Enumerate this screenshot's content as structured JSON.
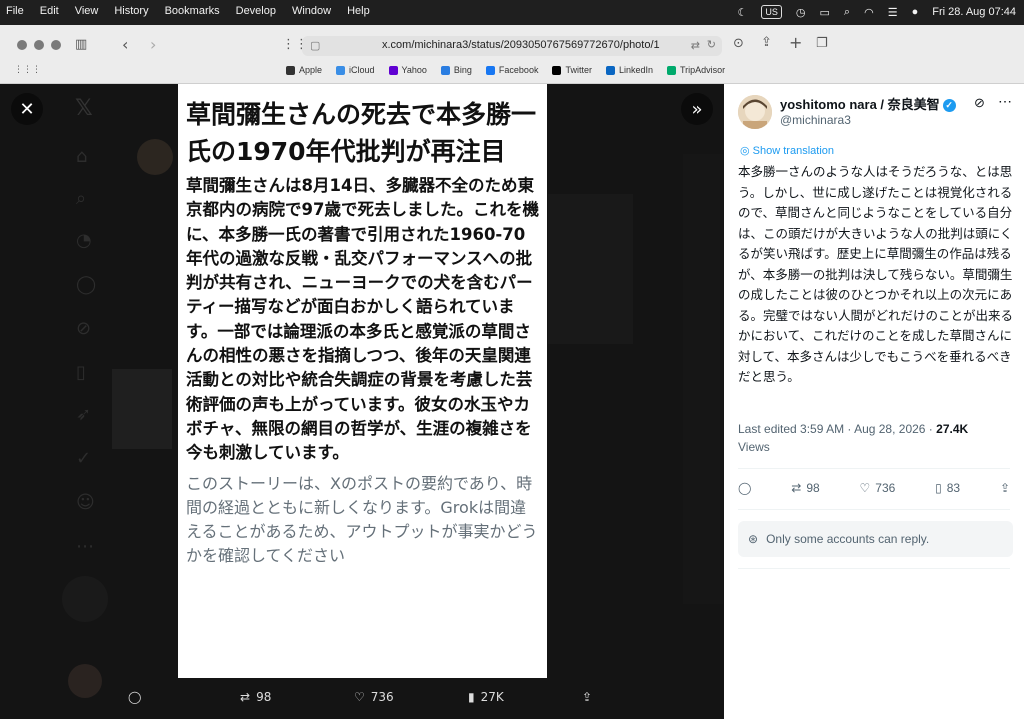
{
  "menubar": {
    "items": [
      "File",
      "Edit",
      "View",
      "History",
      "Bookmarks",
      "Develop",
      "Window",
      "Help"
    ],
    "input_source": "US",
    "clock": "Fri 28. Aug  07:44"
  },
  "browser": {
    "url": "x.com/michinara3/status/2093050767569772670/photo/1",
    "bookmarks": [
      {
        "label": "Apple",
        "icon": "apple-icon",
        "color": "#333333"
      },
      {
        "label": "iCloud",
        "icon": "cloud-icon",
        "color": "#3a8ee6"
      },
      {
        "label": "Yahoo",
        "icon": "yahoo-icon",
        "color": "#6001d2"
      },
      {
        "label": "Bing",
        "icon": "search-icon",
        "color": "#2a7de1"
      },
      {
        "label": "Facebook",
        "icon": "facebook-icon",
        "color": "#1877f2"
      },
      {
        "label": "Twitter",
        "icon": "x-icon",
        "color": "#000000"
      },
      {
        "label": "LinkedIn",
        "icon": "linkedin-icon",
        "color": "#0a66c2"
      },
      {
        "label": "TripAdvisor",
        "icon": "tripadvisor-icon",
        "color": "#00aa6c"
      }
    ]
  },
  "photo": {
    "headline": "草間彌生さんの死去で本多勝一氏の1970年代批判が再注目",
    "body": "草間彌生さんは8月14日、多臓器不全のため東京都内の病院で97歳で死去しました。これを機に、本多勝一氏の著書で引用された1960-70年代の過激な反戦・乱交パフォーマンスへの批判が共有され、ニューヨークでの犬を含むパーティー描写などが面白おかしく語られています。一部では論理派の本多氏と感覚派の草間さんの相性の悪さを指摘しつつ、後年の天皇関連活動との対比や統合失調症の背景を考慮した芸術評価の声も上がっています。彼女の水玉やカボチャ、無限の網目の哲学が、生涯の複雑さを今も刺激しています。",
    "note": "このストーリーは、Xのポストの要約であり、時間の経過とともに新しくなります。Grokは間違えることがあるため、アウトプットが事実かどうかを確認してください"
  },
  "viewer_actions": {
    "retweets": "98",
    "likes": "736",
    "views": "27K"
  },
  "tweet": {
    "display_name": "yoshitomo nara / 奈良美智",
    "handle": "@michinara3",
    "show_translation": "Show translation",
    "text": "本多勝一さんのような人はそうだろうな、とは思う。しかし、世に成し遂げたことは視覚化されるので、草間さんと同じようなことをしている自分は、この頭だけが大きいような人の批判は頭にくるが笑い飛ばす。歴史上に草間彌生の作品は残るが、本多勝一の批判は決して残らない。草間彌生の成したことは彼のひとつかそれ以上の次元にある。完璧ではない人間がどれだけのことが出来るかにおいて、これだけのことを成した草間さんに対して、本多さんは少しでもこうべを垂れるべきだと思う。",
    "edited": "Last edited 3:59 AM · Aug 28, 2026 · ",
    "views_count": "27.4K",
    "views_label": "Views",
    "retweets": "98",
    "likes": "736",
    "bookmarks": "83",
    "reply_notice": "Only some accounts can reply."
  }
}
